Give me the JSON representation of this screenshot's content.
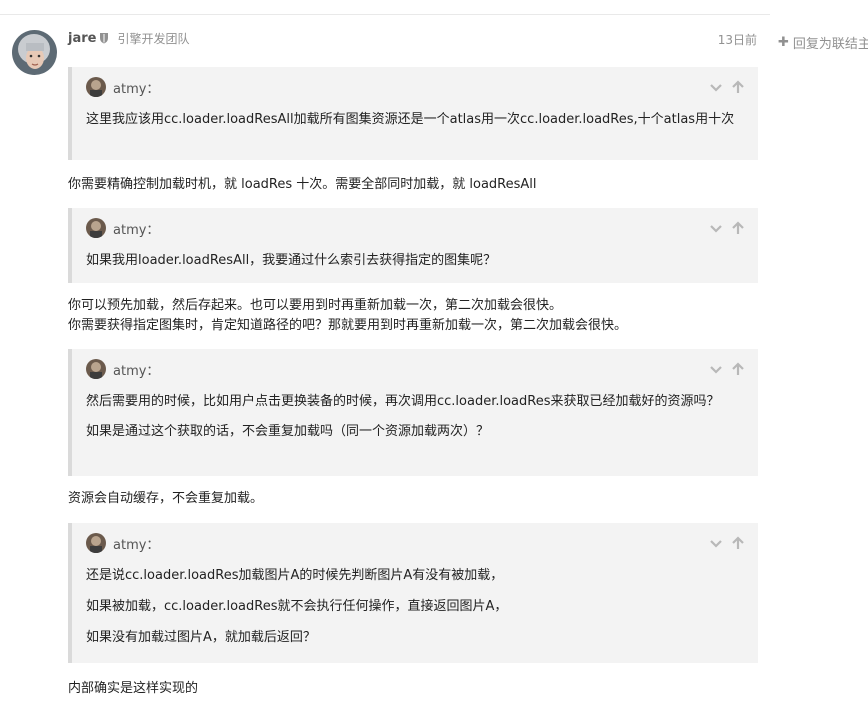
{
  "post": {
    "username": "jare",
    "group": "引擎开发团队",
    "time": "13日前",
    "reply_label": "回复为联结主"
  },
  "quote_user": "atmy：",
  "quotes": [
    {
      "paragraphs": [
        "这里我应该用cc.loader.loadResAll加载所有图集资源还是一个atlas用一次cc.loader.loadRes,十个atlas用十次"
      ]
    },
    {
      "paragraphs": [
        "如果我用loader.loadResAll，我要通过什么索引去获得指定的图集呢？"
      ]
    },
    {
      "paragraphs": [
        "然后需要用的时候，比如用户点击更换装备的时候，再次调用cc.loader.loadRes来获取已经加载好的资源吗？",
        "如果是通过这个获取的话，不会重复加载吗（同一个资源加载两次）？"
      ]
    },
    {
      "paragraphs": [
        "还是说cc.loader.loadRes加载图片A的时候先判断图片A有没有被加载，",
        "如果被加载，cc.loader.loadRes就不会执行任何操作，直接返回图片A，",
        "如果没有加载过图片A，就加载后返回？"
      ]
    }
  ],
  "replies": [
    "你需要精确控制加载时机，就 loadRes 十次。需要全部同时加载，就 loadResAll",
    "你可以预先加载，然后存起来。也可以要用到时再重新加载一次，第二次加载会很快。",
    "你需要获得指定图集时，肯定知道路径的吧？那就要用到时再重新加载一次，第二次加载会很快。",
    "资源会自动缓存，不会重复加载。",
    "内部确实是这样实现的"
  ],
  "icons": {
    "shield": "shield-icon",
    "plus": "plus-icon",
    "chevron": "chevron-down-icon",
    "arrow": "arrow-up-icon"
  }
}
